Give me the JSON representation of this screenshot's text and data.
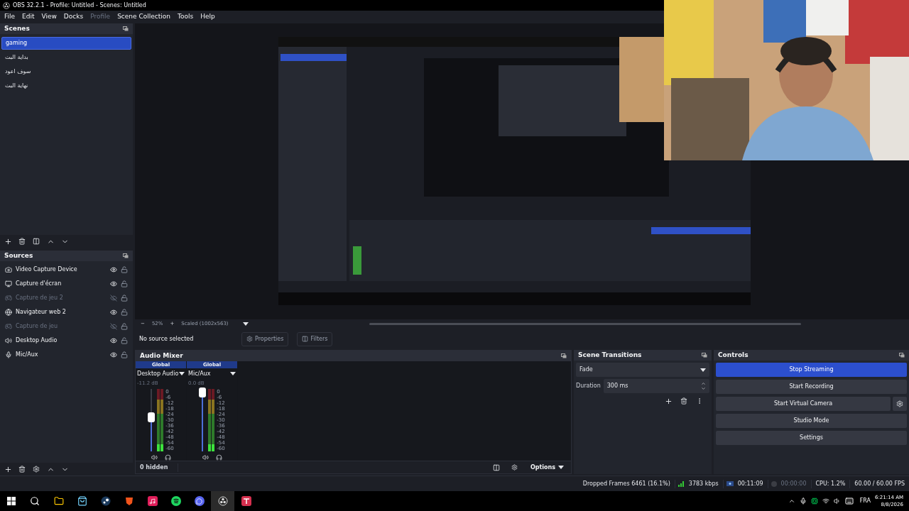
{
  "window": {
    "title": "OBS 32.2.1 - Profile: Untitled - Scenes: Untitled"
  },
  "menu": [
    {
      "label": "File",
      "disabled": false
    },
    {
      "label": "Edit",
      "disabled": false
    },
    {
      "label": "View",
      "disabled": false
    },
    {
      "label": "Docks",
      "disabled": false
    },
    {
      "label": "Profile",
      "disabled": true
    },
    {
      "label": "Scene Collection",
      "disabled": false
    },
    {
      "label": "Tools",
      "disabled": false
    },
    {
      "label": "Help",
      "disabled": false
    }
  ],
  "scenes": {
    "title": "Scenes",
    "items": [
      {
        "name": "gaming",
        "selected": true
      },
      {
        "name": "بداية البث",
        "selected": false
      },
      {
        "name": "سوف اعود",
        "selected": false
      },
      {
        "name": "نهاية البث",
        "selected": false
      }
    ]
  },
  "sources": {
    "title": "Sources",
    "items": [
      {
        "name": "Video Capture Device",
        "kind": "camera",
        "visible": true
      },
      {
        "name": "Capture d'écran",
        "kind": "monitor",
        "visible": true
      },
      {
        "name": "Capture de jeu 2",
        "kind": "game",
        "visible": false
      },
      {
        "name": "Navigateur web 2",
        "kind": "globe",
        "visible": true
      },
      {
        "name": "Capture de jeu",
        "kind": "game",
        "visible": false
      },
      {
        "name": "Desktop Audio",
        "kind": "speaker",
        "visible": true
      },
      {
        "name": "Mic/Aux",
        "kind": "mic",
        "visible": true
      }
    ]
  },
  "preview": {
    "zoom_out": "−",
    "zoom": "52%",
    "zoom_in": "+",
    "scale": "Scaled (1002x563)"
  },
  "source_bar": {
    "status": "No source selected",
    "buttons": [
      {
        "label": "Properties",
        "kind": "gear"
      },
      {
        "label": "Filters",
        "kind": "filter"
      }
    ]
  },
  "audio_mixer": {
    "title": "Audio Mixer",
    "channels": [
      {
        "scope": "Global",
        "name": "Desktop Audio",
        "reading": "-11.2 dB",
        "level": 0.55,
        "scale": [
          "0",
          "-6",
          "-12",
          "-18",
          "-24",
          "-30",
          "-36",
          "-42",
          "-48",
          "-54",
          "-60"
        ]
      },
      {
        "scope": "Global",
        "name": "Mic/Aux",
        "reading": "0.0 dB",
        "level": 0.95,
        "scale": [
          "0",
          "-6",
          "-12",
          "-18",
          "-24",
          "-30",
          "-36",
          "-42",
          "-48",
          "-54",
          "-60"
        ]
      }
    ],
    "hidden": "0 hidden",
    "options": "Options"
  },
  "transitions": {
    "title": "Scene Transitions",
    "transition": "Fade",
    "duration_label": "Duration",
    "duration": "300 ms"
  },
  "controls": {
    "title": "Controls",
    "buttons": [
      {
        "label": "Stop Streaming",
        "active": true
      },
      {
        "label": "Start Recording",
        "active": false
      },
      {
        "label": "Start Virtual Camera",
        "active": false
      },
      {
        "label": "Studio Mode",
        "active": false
      },
      {
        "label": "Settings",
        "active": false
      }
    ]
  },
  "status_bar": {
    "dropped": "Dropped Frames 6461 (16.1%)",
    "bitrate": "3783 kbps",
    "stream_time": "00:11:09",
    "recording": false,
    "record_time": "00:00:00",
    "cpu": "CPU: 1.2%",
    "fps": "60.00 / 60.00 FPS"
  },
  "taskbar": {
    "apps": [
      {
        "kind": "folder",
        "active": false
      },
      {
        "kind": "store",
        "active": false
      },
      {
        "kind": "steam",
        "active": false
      },
      {
        "kind": "lion",
        "active": false
      },
      {
        "kind": "note",
        "active": false
      },
      {
        "kind": "music",
        "active": false
      },
      {
        "kind": "chat",
        "active": false
      },
      {
        "kind": "obs",
        "active": true
      },
      {
        "kind": "tf",
        "active": false
      }
    ],
    "language": "FRA",
    "time": "6:21:14 AM",
    "date": "8/8/2026"
  }
}
